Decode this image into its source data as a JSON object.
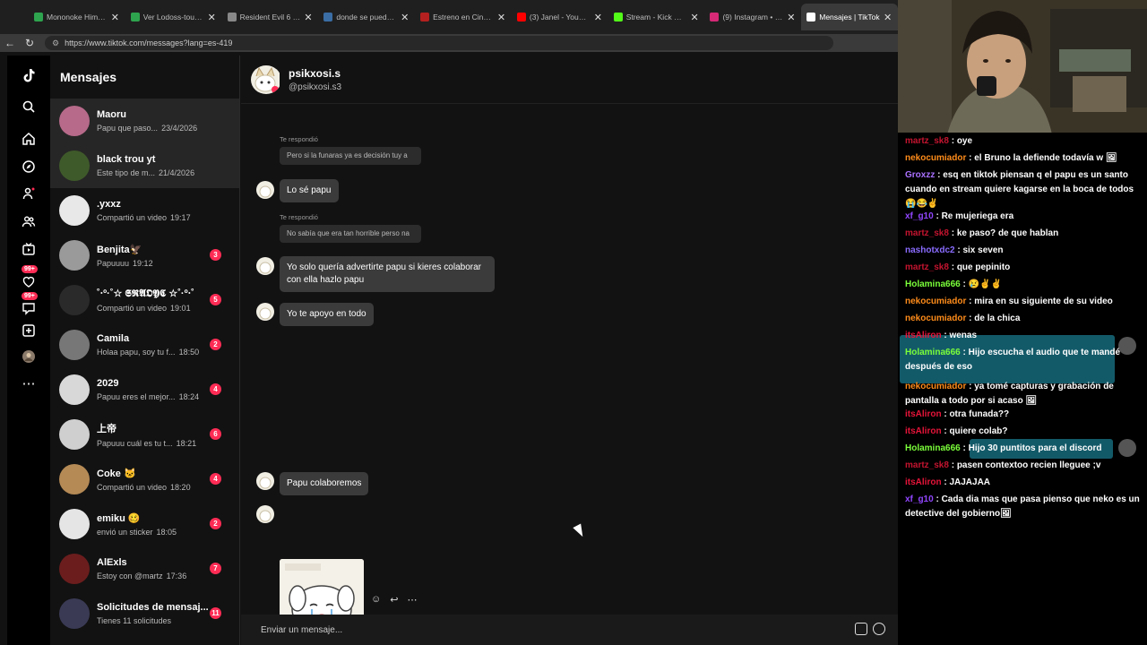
{
  "browser": {
    "tabs": [
      {
        "label": "Mononoke Hime Epi",
        "color": "#2ea44f"
      },
      {
        "label": "Ver Lodoss-tou Sen",
        "color": "#2ea44f"
      },
      {
        "label": "Resident Evil 6 + DL",
        "color": "#888888"
      },
      {
        "label": "donde se puede est",
        "color": "#3a6ea5"
      },
      {
        "label": "Estreno en Cinemark",
        "color": "#b3201f"
      },
      {
        "label": "(3) Janel - YouTube",
        "color": "#ff0000"
      },
      {
        "label": "Stream - Kick Dashb",
        "color": "#53fc18"
      },
      {
        "label": "(9) Instagram • Men",
        "color": "#d62976"
      },
      {
        "label": "Mensajes | TikTok",
        "color": "#ffffff"
      }
    ],
    "url": "https://www.tiktok.com/messages?lang=es-419"
  },
  "sidebar_rail": {
    "badges": [
      "99+",
      "99+"
    ]
  },
  "conversations": {
    "title": "Mensajes",
    "items": [
      {
        "name": "Maoru",
        "preview": "Papu que paso...",
        "time": "23/4/2026",
        "badge": "",
        "avatar": "#b76a8a"
      },
      {
        "name": "black trou yt",
        "preview": "Este tipo de m...",
        "time": "21/4/2026",
        "badge": "",
        "avatar": "#3f5a2a"
      },
      {
        "name": ".yxxz",
        "preview": "Compartió un video",
        "time": "19:17",
        "badge": "",
        "avatar": "#e8e8e8"
      },
      {
        "name": "Benjita🦅",
        "preview": "Papuuuu",
        "time": "19:12",
        "badge": "3",
        "avatar": "#9a9a9a"
      },
      {
        "name": "˚‧º·˚☆ 𝕾𝕽𝕬𝕺𝖄𝕮 ☆˚·º‧˚",
        "preview": "Compartió un video",
        "time": "19:01",
        "badge": "5",
        "avatar": "#2a2a2a"
      },
      {
        "name": "Camila",
        "preview": "Holaa papu, soy tu f...",
        "time": "18:50",
        "badge": "2",
        "avatar": "#777777"
      },
      {
        "name": "2029",
        "preview": "Papuu eres el mejor...",
        "time": "18:24",
        "badge": "4",
        "avatar": "#d8d8d8"
      },
      {
        "name": "上帝",
        "preview": "Papuuu cuál es tu t...",
        "time": "18:21",
        "badge": "6",
        "avatar": "#cfcfcf"
      },
      {
        "name": "Coke 🐱",
        "preview": "Compartió un video",
        "time": "18:20",
        "badge": "4",
        "avatar": "#b58a55"
      },
      {
        "name": "emiku 🥴",
        "preview": "envió un sticker",
        "time": "18:05",
        "badge": "2",
        "avatar": "#e5e5e5"
      },
      {
        "name": "AlExls",
        "preview": "Estoy con @martz",
        "time": "17:36",
        "badge": "7",
        "avatar": "#6b1d1d"
      },
      {
        "name": "Solicitudes de mensaj...",
        "preview": "Tienes 11 solicitudes",
        "time": "",
        "badge": "11",
        "avatar": "#3a3a55"
      }
    ]
  },
  "chat": {
    "display_name": "psikxosi.s",
    "username": "@psikxosi.s3",
    "messages": {
      "replied_label_1": "Te respondió",
      "quote_1": "Pero si la funaras ya es decisión tuy a",
      "msg_1": "Lo sé papu",
      "replied_label_2": "Te respondió",
      "quote_2": "No sabía que era tan horrible perso na",
      "msg_2": "Yo solo quería advertirte papu si kieres colaborar con ella hazlo papu",
      "msg_3": "Yo te apoyo en todo",
      "msg_4": "Papu colaboremos"
    },
    "input_placeholder": "Enviar un mensaje..."
  },
  "stream_chat": [
    {
      "user": "martz_sk8",
      "color": "#c4142f",
      "text": "oye"
    },
    {
      "user": "nekocumiador",
      "color": "#ff8c1a",
      "text": "el Bruno la defiende todavía w 🖼"
    },
    {
      "user": "Groxzz",
      "color": "#a970ff",
      "text": "esq en tiktok piensan q el papu es un santo cuando en stream quiere kagarse en la boca de todos 😭😂✌"
    },
    {
      "user": "xf_g10",
      "color": "#9146ff",
      "text": "Re mujeriega era"
    },
    {
      "user": "martz_sk8",
      "color": "#c4142f",
      "text": "ke paso? de que hablan"
    },
    {
      "user": "nashotxdc2",
      "color": "#8a6cff",
      "text": "six seven"
    },
    {
      "user": "martz_sk8",
      "color": "#c4142f",
      "text": "que pepinito"
    },
    {
      "user": "Holamina666",
      "color": "#7bff3a",
      "text": "😢✌✌"
    },
    {
      "user": "nekocumiador",
      "color": "#ff8c1a",
      "text": "mira en su siguiente de su video"
    },
    {
      "user": "nekocumiador",
      "color": "#ff8c1a",
      "text": "de la chica"
    },
    {
      "user": "itsAliron",
      "color": "#e8143a",
      "text": "wenas"
    },
    {
      "user": "Holamina666",
      "color": "#7bff3a",
      "text": "Hijo escucha el audio que te mandé después de eso"
    },
    {
      "user": "nekocumiador",
      "color": "#ff8c1a",
      "text": "ya tomé capturas y grabación de pantalla a todo por si acaso 🖼"
    },
    {
      "user": "itsAliron",
      "color": "#e8143a",
      "text": "otra funada??"
    },
    {
      "user": "itsAliron",
      "color": "#e8143a",
      "text": "quiere colab?"
    },
    {
      "user": "Holamina666",
      "color": "#7bff3a",
      "text": "Hijo 30 puntitos para el discord"
    },
    {
      "user": "martz_sk8",
      "color": "#c4142f",
      "text": "pasen contextoo recien lleguee ;v"
    },
    {
      "user": "itsAliron",
      "color": "#e8143a",
      "text": "JAJAJAA"
    },
    {
      "user": "xf_g10",
      "color": "#9146ff",
      "text": "Cada dia mas que pasa pienso que neko es un detective del gobierno🖼"
    }
  ]
}
